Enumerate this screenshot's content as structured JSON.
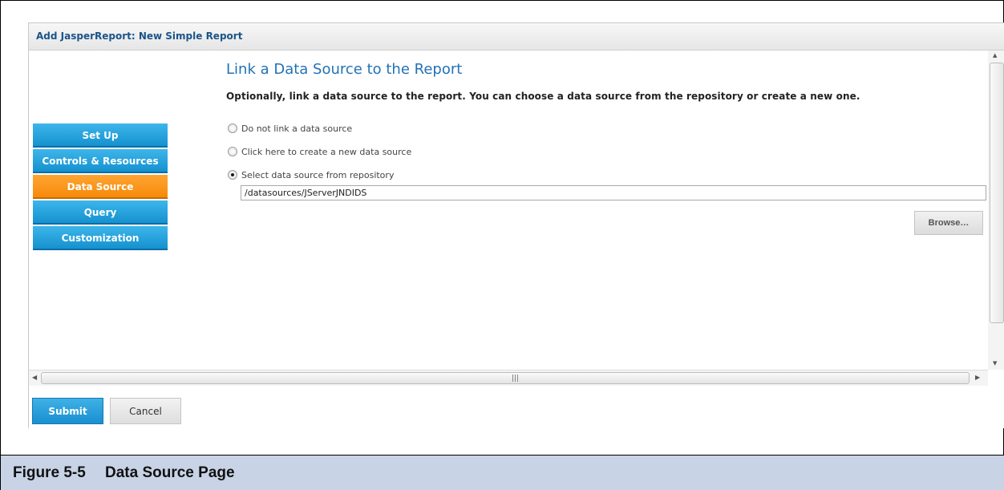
{
  "dialog": {
    "title": "Add JasperReport: New Simple Report"
  },
  "wizard_nav": {
    "items": [
      {
        "label": "Set Up",
        "active": false
      },
      {
        "label": "Controls & Resources",
        "active": false
      },
      {
        "label": "Data Source",
        "active": true
      },
      {
        "label": "Query",
        "active": false
      },
      {
        "label": "Customization",
        "active": false
      }
    ]
  },
  "content": {
    "title": "Link a Data Source to the Report",
    "description": "Optionally, link a data source to the report. You can choose a data source from the repository or create a new one.",
    "options": [
      {
        "label": "Do not link a data source",
        "selected": false
      },
      {
        "label": "Click here to create a new data source",
        "selected": false
      },
      {
        "label": "Select data source from repository",
        "selected": true
      }
    ],
    "repository_path": "/datasources/JServerJNDIDS",
    "browse_label": "Browse…"
  },
  "footer": {
    "submit_label": "Submit",
    "cancel_label": "Cancel"
  },
  "caption": {
    "number": "Figure 5-5",
    "text": "Data Source Page"
  },
  "colors": {
    "nav_blue": "#1591cf",
    "nav_active_orange": "#f68a0a",
    "title_blue": "#2272b7",
    "caption_bg": "#c8d3e6"
  }
}
